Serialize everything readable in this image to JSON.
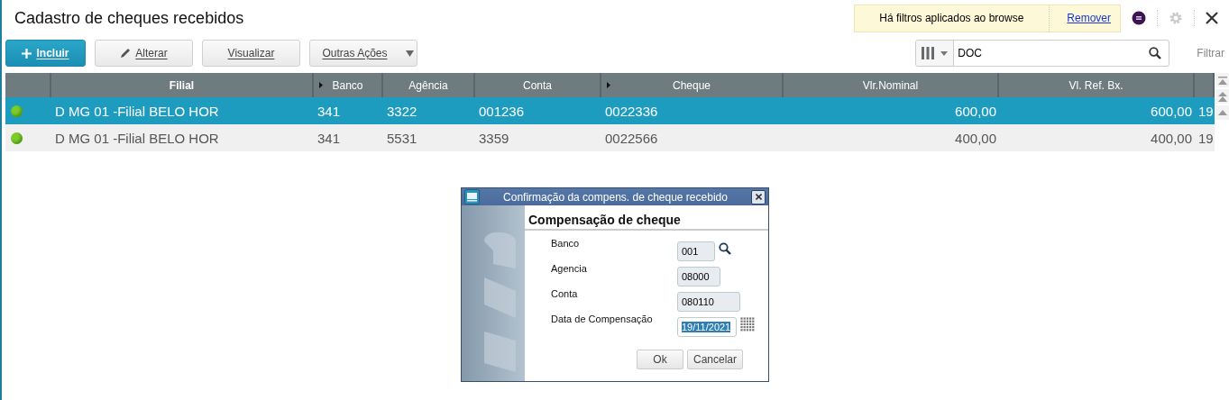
{
  "window": {
    "title": "Cadastro de cheques recebidos"
  },
  "filter_notice": {
    "text": "Há filtros aplicados ao browse",
    "link": "Remover"
  },
  "toolbar": {
    "buttons": [
      {
        "label": "Incluir",
        "kind": "primary"
      },
      {
        "label": "Alterar",
        "kind": "edit"
      },
      {
        "label": "Visualizar",
        "kind": "normal"
      },
      {
        "label": "Outras Ações",
        "kind": "dropdown"
      }
    ]
  },
  "search": {
    "value": "DOC",
    "filter_link": "Filtrar"
  },
  "table": {
    "columns": [
      {
        "label": "Filial",
        "bold": true,
        "sort_marker": false
      },
      {
        "label": "Banco",
        "bold": false,
        "sort_marker": true
      },
      {
        "label": "Agência",
        "bold": false,
        "sort_marker": false
      },
      {
        "label": "Conta",
        "bold": false,
        "sort_marker": false
      },
      {
        "label": "Cheque",
        "bold": false,
        "sort_marker": true
      },
      {
        "label": "Vlr.Nominal",
        "bold": false,
        "sort_marker": false
      },
      {
        "label": "Vl. Ref. Bx.",
        "bold": false,
        "sort_marker": false
      }
    ],
    "rows": [
      {
        "selected": true,
        "color": "#7ccc2a",
        "cells": [
          "D MG 01 -Filial BELO HOR",
          "341",
          "3322",
          "001236",
          "0022336",
          "600,00",
          "600,00",
          "19"
        ]
      },
      {
        "selected": false,
        "color": "#7ccc2a",
        "cells": [
          "D MG 01 -Filial BELO HOR",
          "341",
          "5531",
          "3359",
          "0022566",
          "400,00",
          "400,00",
          "19"
        ]
      }
    ]
  },
  "dialog": {
    "title": "Confirmação da compens. de cheque recebido",
    "heading": "Compensação de cheque",
    "fields": [
      {
        "label": "Banco",
        "value": "001",
        "kind": "lookup",
        "selected": false
      },
      {
        "label": "Agencia",
        "value": "08000",
        "kind": "plain",
        "selected": false
      },
      {
        "label": "Conta",
        "value": "080110",
        "kind": "plain",
        "selected": false
      },
      {
        "label": "Data de Compensação",
        "value": "19/11/2021",
        "kind": "date",
        "selected": true
      }
    ],
    "buttons": [
      "Ok",
      "Cancelar"
    ]
  }
}
